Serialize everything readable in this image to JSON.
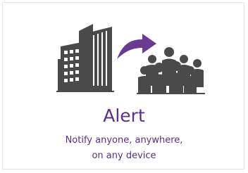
{
  "card": {
    "title": "Alert",
    "subtitle_line1": "Notify anyone, anywhere,",
    "subtitle_line2": "on any device"
  },
  "icons": {
    "building": "building-icon",
    "arrow": "curved-arrow-icon",
    "people": "group-people-icon"
  },
  "colors": {
    "accent": "#5b2e86",
    "icon_dark": "#4a4a4a",
    "border": "#e4e4e4"
  }
}
